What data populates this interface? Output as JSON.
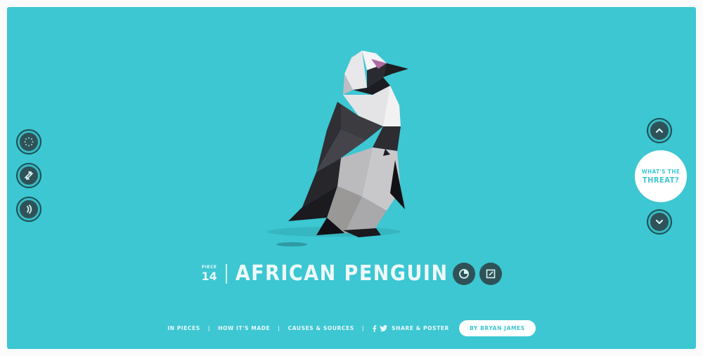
{
  "piece": {
    "label": "PIECE",
    "number": "14"
  },
  "species": {
    "name": "AFRICAN PENGUIN"
  },
  "threat_button": {
    "line1": "WHAT'S THE",
    "line2": "THREAT?"
  },
  "footer": {
    "links": [
      "IN PIECES",
      "HOW IT'S MADE",
      "CAUSES & SOURCES",
      "SHARE & POSTER"
    ],
    "separator": "|",
    "byline": "BY BRYAN JAMES"
  },
  "colors": {
    "background": "#3cc7d2",
    "dark_button": "#2e5257",
    "text_light": "#eef9fa"
  }
}
